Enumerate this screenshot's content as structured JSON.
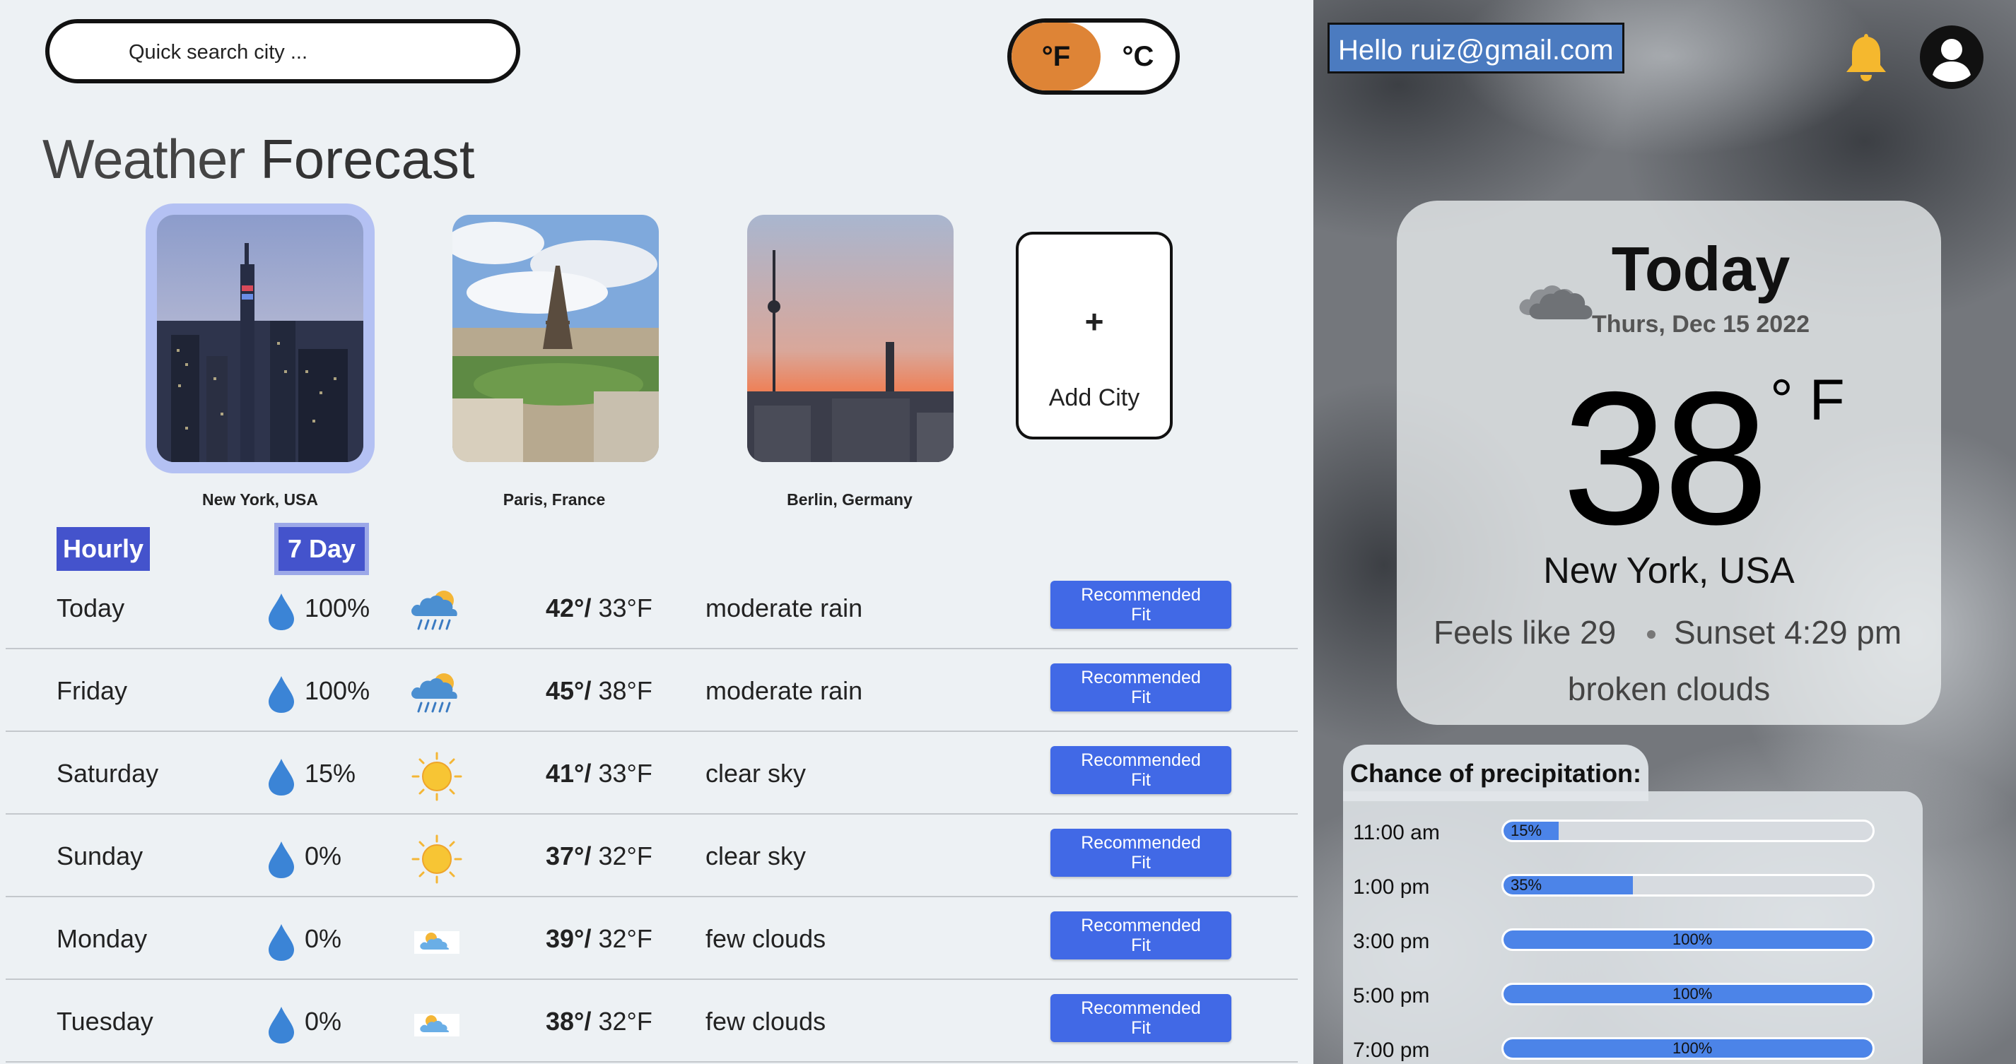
{
  "search": {
    "placeholder": "Quick search city ..."
  },
  "units": {
    "f": "°F",
    "c": "°C",
    "selected": "°F"
  },
  "title": {
    "light": "Weather",
    "bold": "Forecast"
  },
  "cities": [
    {
      "name": "New York, USA",
      "selected": true
    },
    {
      "name": "Paris, France",
      "selected": false
    },
    {
      "name": "Berlin, Germany",
      "selected": false
    }
  ],
  "add_city": {
    "plus": "+",
    "label": "Add City"
  },
  "tabs": {
    "hourly": "Hourly",
    "seven_day": "7 Day"
  },
  "forecast": [
    {
      "day": "Today",
      "precip": "100%",
      "icon": "rain-sun-icon",
      "hi": "42°",
      "sep": "/",
      "lo": "33°F",
      "desc": "moderate rain",
      "fit": "Recommended Fit"
    },
    {
      "day": "Friday",
      "precip": "100%",
      "icon": "rain-sun-icon",
      "hi": "45°",
      "sep": "/",
      "lo": "38°F",
      "desc": "moderate rain",
      "fit": "Recommended Fit"
    },
    {
      "day": "Saturday",
      "precip": "15%",
      "icon": "sun-icon",
      "hi": "41°",
      "sep": "/",
      "lo": "33°F",
      "desc": "clear sky",
      "fit": "Recommended Fit"
    },
    {
      "day": "Sunday",
      "precip": "0%",
      "icon": "sun-icon",
      "hi": "37°",
      "sep": "/",
      "lo": "32°F",
      "desc": "clear sky",
      "fit": "Recommended Fit"
    },
    {
      "day": "Monday",
      "precip": "0%",
      "icon": "few-clouds-icon",
      "hi": "39°",
      "sep": "/",
      "lo": "32°F",
      "desc": "few clouds",
      "fit": "Recommended Fit"
    },
    {
      "day": "Tuesday",
      "precip": "0%",
      "icon": "few-clouds-icon",
      "hi": "38°",
      "sep": "/",
      "lo": "32°F",
      "desc": "few clouds",
      "fit": "Recommended Fit"
    }
  ],
  "user": {
    "greeting": "Hello ruiz@gmail.com"
  },
  "today": {
    "title": "Today",
    "date": "Thurs, Dec 15 2022",
    "temp": "38",
    "unit": "° F",
    "city": "New York, USA",
    "feels": "Feels like 29",
    "sunset": "Sunset 4:29 pm",
    "condition": "broken clouds"
  },
  "precipitation": {
    "title": "Chance of precipitation:",
    "hours": [
      {
        "time": "11:00 am",
        "label": "15%",
        "value": 15
      },
      {
        "time": "1:00 pm",
        "label": "35%",
        "value": 35
      },
      {
        "time": "3:00 pm",
        "label": "100%",
        "value": 100
      },
      {
        "time": "5:00 pm",
        "label": "100%",
        "value": 100
      },
      {
        "time": "7:00 pm",
        "label": "100%",
        "value": 100
      }
    ]
  },
  "colors": {
    "accent_orange": "#de8436",
    "tab_blue": "#4453cc",
    "button_blue": "#4169e6",
    "bar_blue": "#4c84e8",
    "bell_yellow": "#f5b82e",
    "greeting_blue": "#4b7bc0"
  }
}
